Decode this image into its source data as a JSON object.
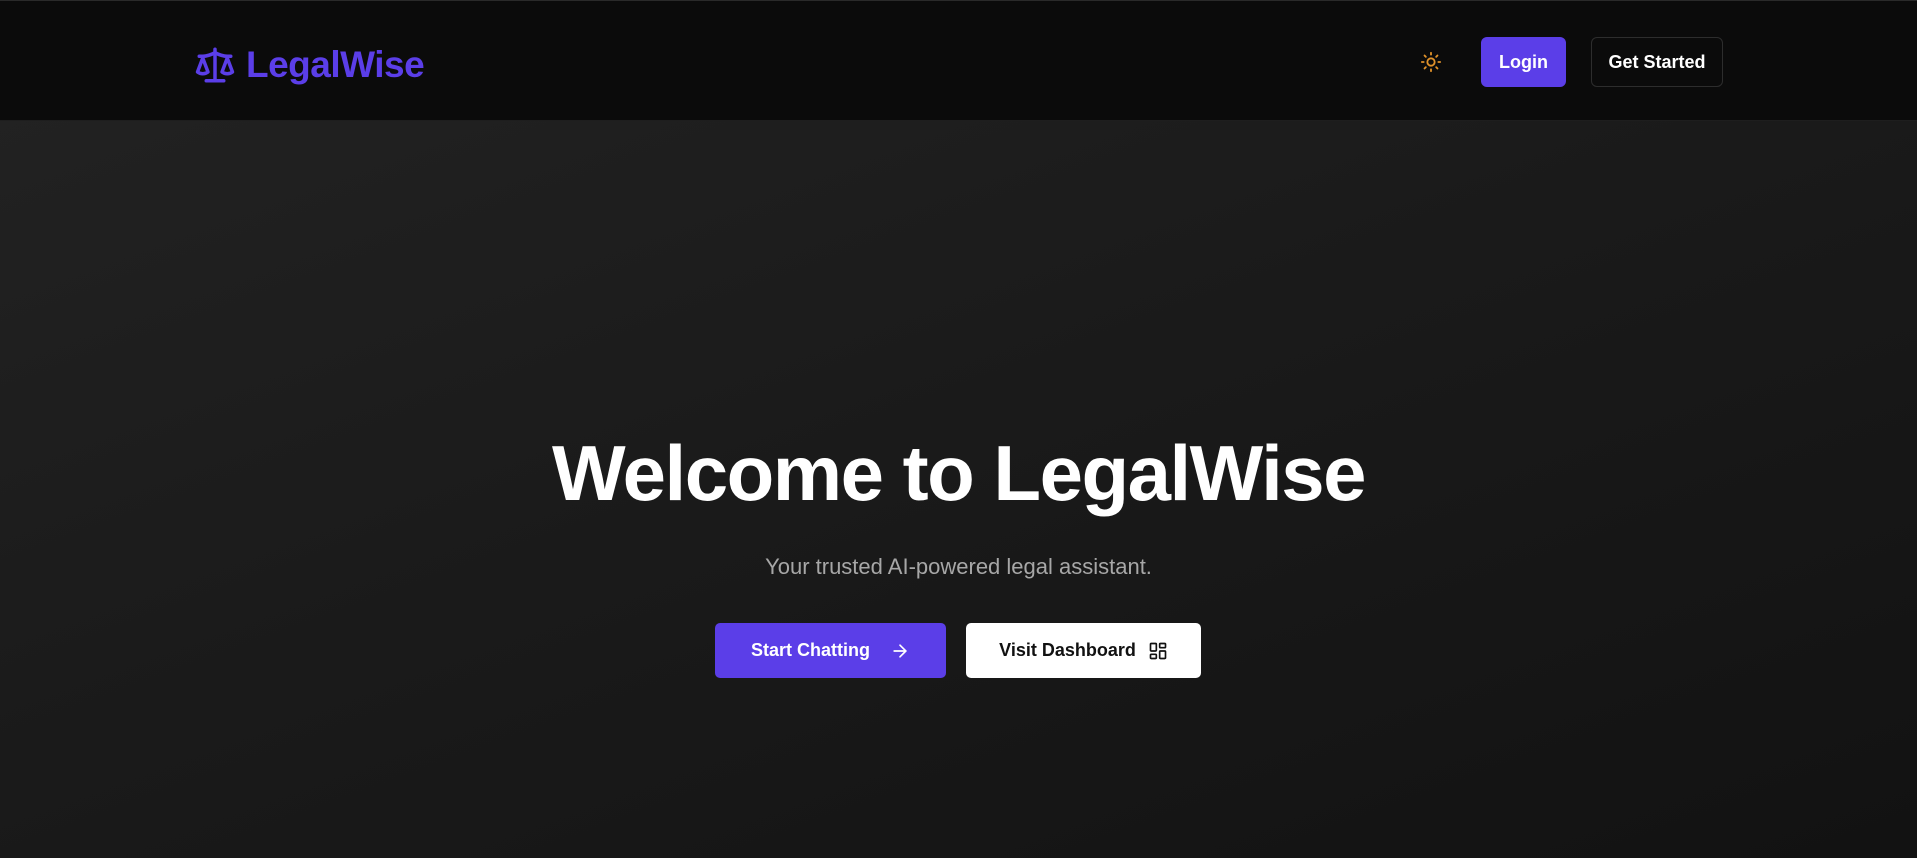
{
  "navbar": {
    "brand_name": "LegalWise",
    "brand_icon": "scale-icon",
    "theme_icon": "sun-icon",
    "login_label": "Login",
    "get_started_label": "Get Started"
  },
  "hero": {
    "title": "Welcome to LegalWise",
    "subtitle": "Your trusted AI-powered legal assistant.",
    "start_chatting_label": "Start Chatting",
    "start_chatting_icon": "arrow-right-icon",
    "visit_dashboard_label": "Visit Dashboard",
    "visit_dashboard_icon": "dashboard-grid-icon"
  },
  "colors": {
    "brand": "#5b3ee8",
    "navbar_bg": "#0b0b0b",
    "hero_bg": "#1a1a1a",
    "sun_icon": "#e0922a",
    "subtitle_text": "#a7a7a7"
  }
}
